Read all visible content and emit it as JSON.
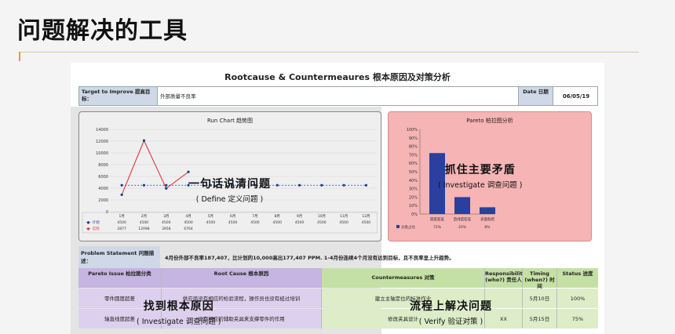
{
  "slide": {
    "title": "问题解决的工具"
  },
  "sheet": {
    "title": "Rootcause & Countermeaures 根本原因及对策分析",
    "target_label": "Target to Improve 提高目标：",
    "target_value": "外部质量不良率",
    "date_label": "Date 日期",
    "date_value": "06/05/19"
  },
  "run_chart": {
    "title": "Run Chart 趋势图",
    "y_ticks": [
      "14000",
      "12000",
      "10000",
      "8000",
      "6000",
      "4000",
      "2000",
      "0"
    ],
    "months": [
      "1月",
      "2月",
      "3月",
      "4月",
      "5月",
      "6月",
      "7月",
      "8月",
      "9月",
      "10月",
      "11月",
      "12月"
    ],
    "plan_label": "计划",
    "actual_label": "实际",
    "plan_row": [
      "4500",
      "4500",
      "4500",
      "4500",
      "4500",
      "4500",
      "4500",
      "4500",
      "4500",
      "4500",
      "4500",
      "4500"
    ],
    "actual_row": [
      "2877",
      "12098",
      "3958",
      "6764",
      "",
      "",
      "",
      "",
      "",
      "",
      "",
      ""
    ]
  },
  "pareto": {
    "title": "Pareto 柏拉图分析",
    "y_ticks": [
      "100%",
      "90%",
      "80%",
      "70%",
      "60%",
      "50%",
      "40%",
      "30%",
      "20%",
      "10%",
      "0%"
    ],
    "categories": [
      "圆度超差",
      "直线度超差",
      "表面粘结"
    ],
    "values": [
      "72%",
      "20%",
      "8%"
    ],
    "legend": "分类占比"
  },
  "annotations": {
    "define_big": "一句话说清问题",
    "define_small": "( Define 定义问题 )",
    "investigate_big": "抓住主要矛盾",
    "investigate_small": "( Investigate 调查问题 )",
    "root_big": "找到根本原因",
    "root_small": "( Investigate 调查问题 )",
    "flow_big": "流程上解决问题",
    "flow_small": "( Verify 验证对策 )"
  },
  "problem": {
    "label": "Problem Statement 问题描述：",
    "text": "4月份外部不良率187,407，比计划的10,000高出177,407 PPM. 1-4月份连续4个月没有达到目标，且不良率呈上升趋势。"
  },
  "table": {
    "headers": [
      "Pareto Issue 柏拉图分类",
      "Root Cause 根本原因",
      "Countermeasures 对策",
      "Responsibility (who?) 责任人",
      "Timing (when?) 时间",
      "Status 进度"
    ],
    "rows": [
      [
        "零件圆度超差",
        "供应商没有相应的检验流程，操作员也没有经过培训",
        "建立主轴定位的标准作业",
        "",
        "5月10日",
        "100%"
      ],
      [
        "轴直线度超差",
        "没有相应的辅助夹具来支撑零件的作用",
        "修改夹具设计",
        "XX",
        "5月15日",
        "75%"
      ]
    ]
  },
  "chart_data": [
    {
      "type": "line",
      "title": "Run Chart 趋势图",
      "categories": [
        "1月",
        "2月",
        "3月",
        "4月",
        "5月",
        "6月",
        "7月",
        "8月",
        "9月",
        "10月",
        "11月",
        "12月"
      ],
      "ylim": [
        0,
        14000
      ],
      "series": [
        {
          "name": "计划",
          "values": [
            4500,
            4500,
            4500,
            4500,
            4500,
            4500,
            4500,
            4500,
            4500,
            4500,
            4500,
            4500
          ]
        },
        {
          "name": "实际",
          "values": [
            2877,
            12098,
            3958,
            6764
          ]
        }
      ]
    },
    {
      "type": "bar",
      "title": "Pareto 柏拉图分析",
      "categories": [
        "圆度超差",
        "直线度超差",
        "表面粘结"
      ],
      "values": [
        72,
        20,
        8
      ],
      "ylim": [
        0,
        100
      ],
      "series": [
        {
          "name": "分类占比",
          "values": [
            72,
            20,
            8
          ]
        }
      ]
    }
  ],
  "colors": {
    "plan": "#1f3c88",
    "actual": "#d9363e",
    "pareto_bar": "#2b3f9e",
    "pareto_bg": "#f6b4b4"
  }
}
